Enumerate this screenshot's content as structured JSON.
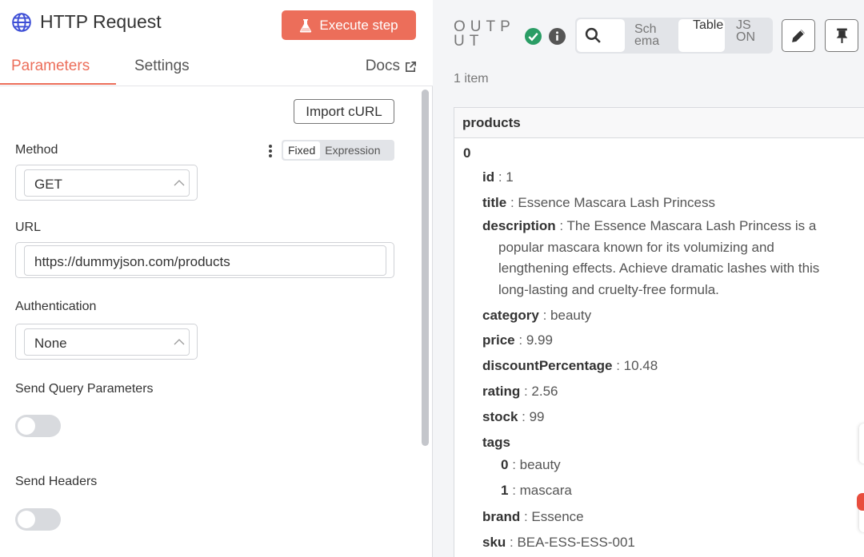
{
  "node": {
    "title": "HTTP Request",
    "icon": "globe-icon",
    "execute_label": "Execute step",
    "execute_color": "#ec6e5a",
    "tabs": [
      {
        "label": "Parameters",
        "active": true
      },
      {
        "label": "Settings",
        "active": false
      }
    ],
    "docs_label": "Docs"
  },
  "params": {
    "import_curl_label": "Import cURL",
    "method": {
      "label": "Method",
      "value": "GET",
      "mode_options": [
        "Fixed",
        "Expression"
      ],
      "mode_selected": "Fixed"
    },
    "url": {
      "label": "URL",
      "value": "https://dummyjson.com/products"
    },
    "authentication": {
      "label": "Authentication",
      "value": "None"
    },
    "send_query": {
      "label": "Send Query Parameters",
      "enabled": false
    },
    "send_headers": {
      "label": "Send Headers",
      "enabled": false
    }
  },
  "output": {
    "label": "OUTPUT",
    "status": "success",
    "view_options": [
      "Schema",
      "Table",
      "JSON"
    ],
    "view_selected": "Table",
    "item_count": "1 item",
    "column_header": "products",
    "index": "0",
    "fields": [
      {
        "key": "id",
        "value": "1"
      },
      {
        "key": "title",
        "value": "Essence Mascara Lash Princess"
      },
      {
        "key": "description",
        "value": "The Essence Mascara Lash Princess is a popular mascara known for its volumizing and lengthening effects. Achieve dramatic lashes with this long-lasting and cruelty-free formula."
      },
      {
        "key": "category",
        "value": "beauty"
      },
      {
        "key": "price",
        "value": "9.99"
      },
      {
        "key": "discountPercentage",
        "value": "10.48"
      },
      {
        "key": "rating",
        "value": "2.56"
      },
      {
        "key": "stock",
        "value": "99"
      }
    ],
    "tags": {
      "key": "tags",
      "items": [
        {
          "key": "0",
          "value": "beauty"
        },
        {
          "key": "1",
          "value": "mascara"
        }
      ]
    },
    "trailing_fields": [
      {
        "key": "brand",
        "value": "Essence"
      },
      {
        "key": "sku",
        "value": "BEA-ESS-ESS-001"
      }
    ]
  }
}
